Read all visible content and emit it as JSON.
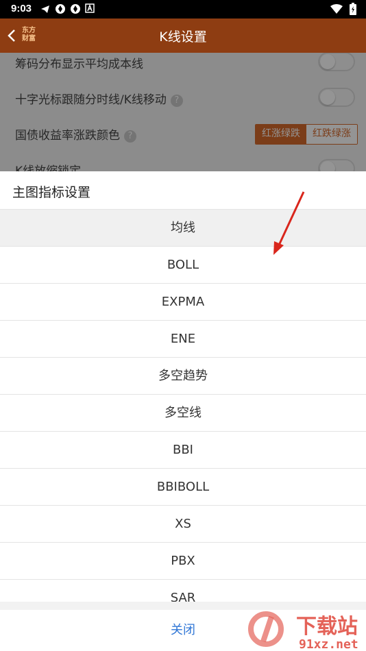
{
  "status_bar": {
    "time": "9:03"
  },
  "nav": {
    "logo_line1": "东方",
    "logo_line2": "财富",
    "title": "K线设置"
  },
  "settings": [
    {
      "label": "筹码分布显示平均成本线"
    },
    {
      "label": "十字光标跟随分时线/K线移动"
    },
    {
      "label": "国债收益率涨跌颜色",
      "options": [
        "红涨绿跌",
        "红跌绿涨"
      ]
    },
    {
      "label": "K线放缩锁定"
    }
  ],
  "sheet": {
    "title": "主图指标设置",
    "items": [
      "均线",
      "BOLL",
      "EXPMA",
      "ENE",
      "多空趋势",
      "多空线",
      "BBI",
      "BBIBOLL",
      "XS",
      "PBX",
      "SAR"
    ],
    "close": "关闭"
  },
  "watermark": {
    "text1": "下载站",
    "text2": "91xz.net"
  },
  "colors": {
    "nav_bg": "#8e3d12",
    "accent": "#d4692c",
    "close_link": "#2f76d6",
    "annotation_arrow": "#d9261c"
  }
}
